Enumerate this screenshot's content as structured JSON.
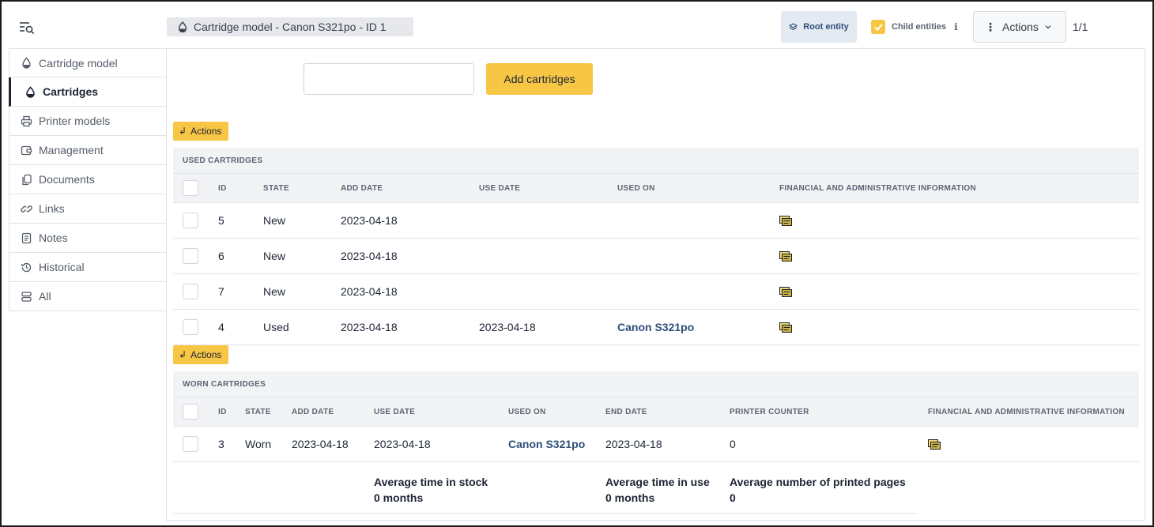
{
  "header": {
    "title": "Cartridge model -  Canon S321po - ID 1",
    "root_entity_label": "Root entity",
    "child_entities_label": "Child entities",
    "actions_label": "Actions",
    "pager": "1/1"
  },
  "sidebar": {
    "items": [
      {
        "label": "Cartridge model",
        "icon": "droplet-icon"
      },
      {
        "label": "Cartridges",
        "icon": "droplet-icon"
      },
      {
        "label": "Printer models",
        "icon": "printer-icon"
      },
      {
        "label": "Management",
        "icon": "wallet-icon"
      },
      {
        "label": "Documents",
        "icon": "documents-icon"
      },
      {
        "label": "Links",
        "icon": "link-icon"
      },
      {
        "label": "Notes",
        "icon": "notes-icon"
      },
      {
        "label": "Historical",
        "icon": "history-icon"
      },
      {
        "label": "All",
        "icon": "all-icon"
      }
    ]
  },
  "add": {
    "input_value": "",
    "button_label": "Add cartridges"
  },
  "massive_actions_label": "Actions",
  "used": {
    "caption": "USED CARTRIDGES",
    "headers": {
      "id": "ID",
      "state": "STATE",
      "add_date": "ADD DATE",
      "use_date": "USE DATE",
      "used_on": "USED ON",
      "financial": "FINANCIAL AND ADMINISTRATIVE INFORMATION"
    },
    "rows": [
      {
        "id": "5",
        "state": "New",
        "add_date": "2023-04-18",
        "use_date": "",
        "used_on": ""
      },
      {
        "id": "6",
        "state": "New",
        "add_date": "2023-04-18",
        "use_date": "",
        "used_on": ""
      },
      {
        "id": "7",
        "state": "New",
        "add_date": "2023-04-18",
        "use_date": "",
        "used_on": ""
      },
      {
        "id": "4",
        "state": "Used",
        "add_date": "2023-04-18",
        "use_date": "2023-04-18",
        "used_on": "Canon S321po"
      }
    ]
  },
  "worn": {
    "caption": "WORN CARTRIDGES",
    "headers": {
      "id": "ID",
      "state": "STATE",
      "add_date": "ADD DATE",
      "use_date": "USE DATE",
      "used_on": "USED ON",
      "end_date": "END DATE",
      "printer_counter": "PRINTER COUNTER",
      "financial": "FINANCIAL AND ADMINISTRATIVE INFORMATION"
    },
    "rows": [
      {
        "id": "3",
        "state": "Worn",
        "add_date": "2023-04-18",
        "use_date": "2023-04-18",
        "used_on": "Canon S321po",
        "end_date": "2023-04-18",
        "printer_counter": "0"
      }
    ],
    "summary": {
      "stock_label": "Average time in stock",
      "stock_value": "0 months",
      "use_label": "Average time in use",
      "use_value": "0 months",
      "pages_label": "Average number of printed pages",
      "pages_value": "0"
    }
  },
  "colors": {
    "accent": "#f7c645",
    "link": "#2f4e78",
    "text": "#1d2433"
  }
}
